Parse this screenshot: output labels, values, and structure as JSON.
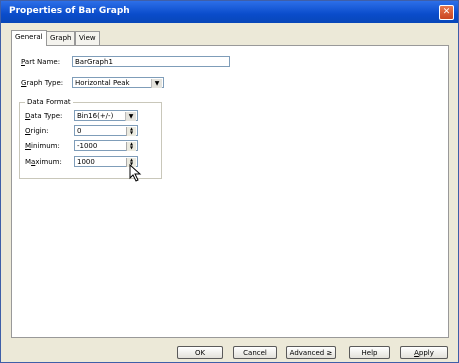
{
  "window": {
    "title": "Properties of Bar Graph"
  },
  "tabs": [
    "General",
    "Graph",
    "View"
  ],
  "general": {
    "part_name_label_u": "P",
    "part_name_label": "art Name:",
    "part_name_value": "BarGraph1",
    "graph_type_label_u": "G",
    "graph_type_label": "raph Type:",
    "graph_type_value": "Horizontal Peak",
    "data_format_title": "Data Format",
    "data_type_label_u": "D",
    "data_type_label": "ata Type:",
    "data_type_value": "Bin16(+/-)",
    "origin_label_u": "O",
    "origin_label": "rigin:",
    "origin_value": "0",
    "minimum_label_u": "M",
    "minimum_label": "inimum:",
    "minimum_value": "-1000",
    "maximum_label_pre": "M",
    "maximum_label_u": "a",
    "maximum_label": "ximum:",
    "maximum_value": "1000"
  },
  "buttons": {
    "ok": "OK",
    "cancel": "Cancel",
    "advanced": "Advanced ≥",
    "help": "Help",
    "apply_u": "A",
    "apply": "pply"
  }
}
